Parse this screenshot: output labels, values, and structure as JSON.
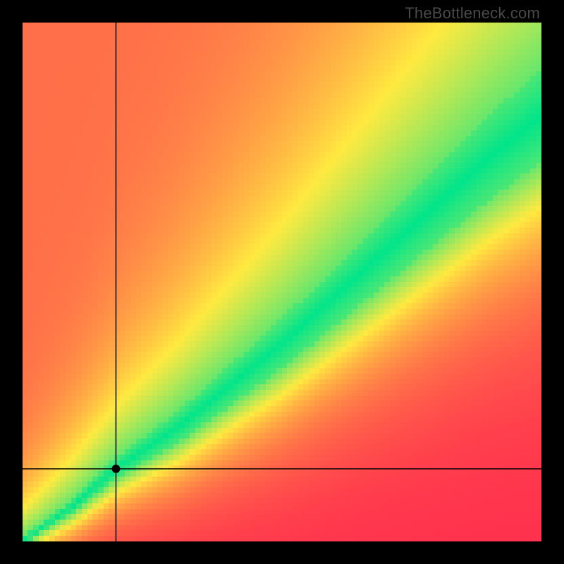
{
  "attribution": "TheBottleneck.com",
  "chart_data": {
    "type": "heatmap",
    "title": "",
    "xlabel": "",
    "ylabel": "",
    "xlim": [
      0,
      100
    ],
    "ylim": [
      0,
      100
    ],
    "legend": null,
    "crosshair": {
      "x": 18,
      "y": 14
    },
    "marker": {
      "x": 18,
      "y": 14
    },
    "optimal_ridge": {
      "description": "green band center: required y for given x",
      "points": [
        {
          "x": 0,
          "y": 0
        },
        {
          "x": 10,
          "y": 7
        },
        {
          "x": 18,
          "y": 14
        },
        {
          "x": 30,
          "y": 22
        },
        {
          "x": 40,
          "y": 30
        },
        {
          "x": 50,
          "y": 38
        },
        {
          "x": 60,
          "y": 47
        },
        {
          "x": 70,
          "y": 56
        },
        {
          "x": 80,
          "y": 65
        },
        {
          "x": 90,
          "y": 74
        },
        {
          "x": 100,
          "y": 82
        }
      ]
    },
    "band_width_pct": {
      "at_x_0": 1,
      "at_x_100": 18
    },
    "color_scale": {
      "0.0": "#ff2b4e",
      "0.5": "#ffe940",
      "1.0": "#00e58b"
    },
    "grid_resolution": 96
  },
  "colors": {
    "background": "#000000",
    "attribution_text": "#4a4a4a",
    "crosshair": "#000000",
    "marker_fill": "#000000"
  }
}
